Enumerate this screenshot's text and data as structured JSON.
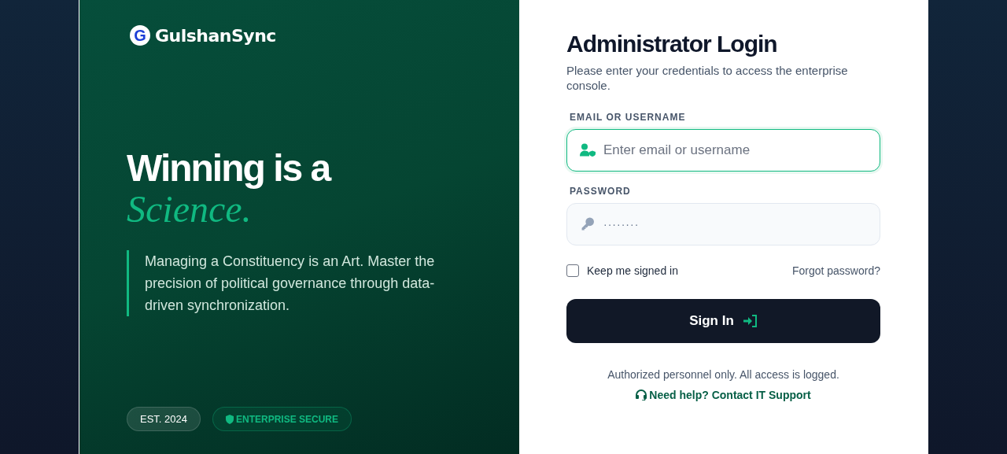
{
  "brand": {
    "logo_letter": "G",
    "name": "GulshanSync"
  },
  "hero": {
    "headline": "Winning is a",
    "accent": "Science.",
    "quote": "Managing a Constituency is an Art. Master the precision of political governance through data-driven synchronization."
  },
  "badges": [
    {
      "label": "EST. 2024",
      "kind": "plain"
    },
    {
      "label": "ENTERPRISE SECURE",
      "kind": "secure"
    }
  ],
  "login": {
    "title": "Administrator Login",
    "subtitle": "Please enter your credentials to access the enterprise console.",
    "fields": [
      {
        "label": "EMAIL OR USERNAME",
        "placeholder": "Enter email or username",
        "kind": "user",
        "focused": true
      },
      {
        "label": "PASSWORD",
        "value": "········",
        "kind": "password",
        "focused": false
      }
    ],
    "remember": {
      "label": "Keep me signed in",
      "checked": false
    },
    "forgot": "Forgot password?",
    "submit": "Sign In",
    "notice": "Authorized personnel only. All access is logged.",
    "help": "Need help? Contact IT Support"
  }
}
